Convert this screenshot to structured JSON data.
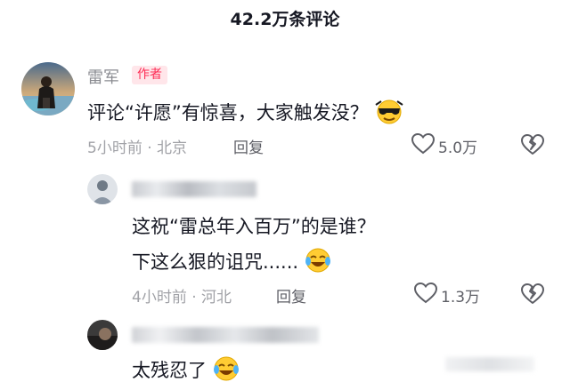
{
  "header": {
    "title": "42.2万条评论"
  },
  "comments": [
    {
      "username": "雷军",
      "badge": "作者",
      "text": "评论“许愿”有惊喜，大家触发没？",
      "emoji": "cool-sunglasses-emoji",
      "meta": "5小时前 · 北京",
      "reply_label": "回复",
      "likes": "5.0万"
    },
    {
      "text_line1": "这祝“雷总年入百万”的是谁？",
      "text_line2": "下这么狠的诅咒......",
      "emoji": "laugh-cry-emoji",
      "meta": "4小时前 · 河北",
      "reply_label": "回复",
      "likes": "1.3万"
    },
    {
      "text": "太残忍了",
      "emoji": "laugh-cry-emoji"
    }
  ],
  "icons": {
    "like": "heart-outline-icon",
    "dislike": "broken-heart-icon"
  },
  "colors": {
    "text_primary": "#161823",
    "text_secondary": "#a1a2a7",
    "badge_red": "#fe2c55"
  }
}
